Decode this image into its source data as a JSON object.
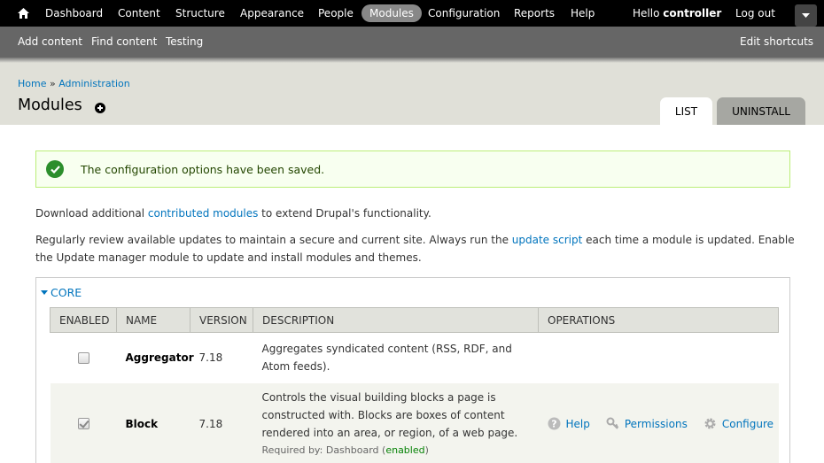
{
  "toolbar": {
    "nav": [
      "Dashboard",
      "Content",
      "Structure",
      "Appearance",
      "People",
      "Modules",
      "Configuration",
      "Reports",
      "Help"
    ],
    "active": "Modules",
    "hello": "Hello",
    "user": "controller",
    "logout": "Log out"
  },
  "shortcuts": {
    "items": [
      "Add content",
      "Find content",
      "Testing"
    ],
    "edit": "Edit shortcuts"
  },
  "breadcrumb": {
    "home": "Home",
    "sep": "»",
    "admin": "Administration"
  },
  "page_title": "Modules",
  "tabs": {
    "list": "LIST",
    "uninstall": "UNINSTALL"
  },
  "message": "The configuration options have been saved.",
  "intro": {
    "p1_before": "Download additional ",
    "p1_link": "contributed modules",
    "p1_after": " to extend Drupal's functionality.",
    "p2_before": "Regularly review available updates to maintain a secure and current site. Always run the ",
    "p2_link": "update script",
    "p2_after": " each time a module is updated. Enable the Update manager module to update and install modules and themes."
  },
  "fieldset_legend": "CORE",
  "table": {
    "headers": [
      "ENABLED",
      "NAME",
      "VERSION",
      "DESCRIPTION",
      "OPERATIONS"
    ],
    "rows": [
      {
        "enabled": false,
        "name": "Aggregator",
        "version": "7.18",
        "description": "Aggregates syndicated content (RSS, RDF, and Atom feeds)."
      },
      {
        "enabled": true,
        "name": "Block",
        "version": "7.18",
        "description": "Controls the visual building blocks a page is constructed with. Blocks are boxes of content rendered into an area, or region, of a web page.",
        "required_by_label": "Required by: Dashboard (",
        "required_by_status": "enabled",
        "required_by_close": ")",
        "operations": [
          "Help",
          "Permissions",
          "Configure"
        ]
      }
    ]
  },
  "colors": {
    "link": "#0074bd",
    "toolbar": "#000000",
    "shortcuts_bar": "#666666",
    "message_bg": "#f8fff0"
  }
}
